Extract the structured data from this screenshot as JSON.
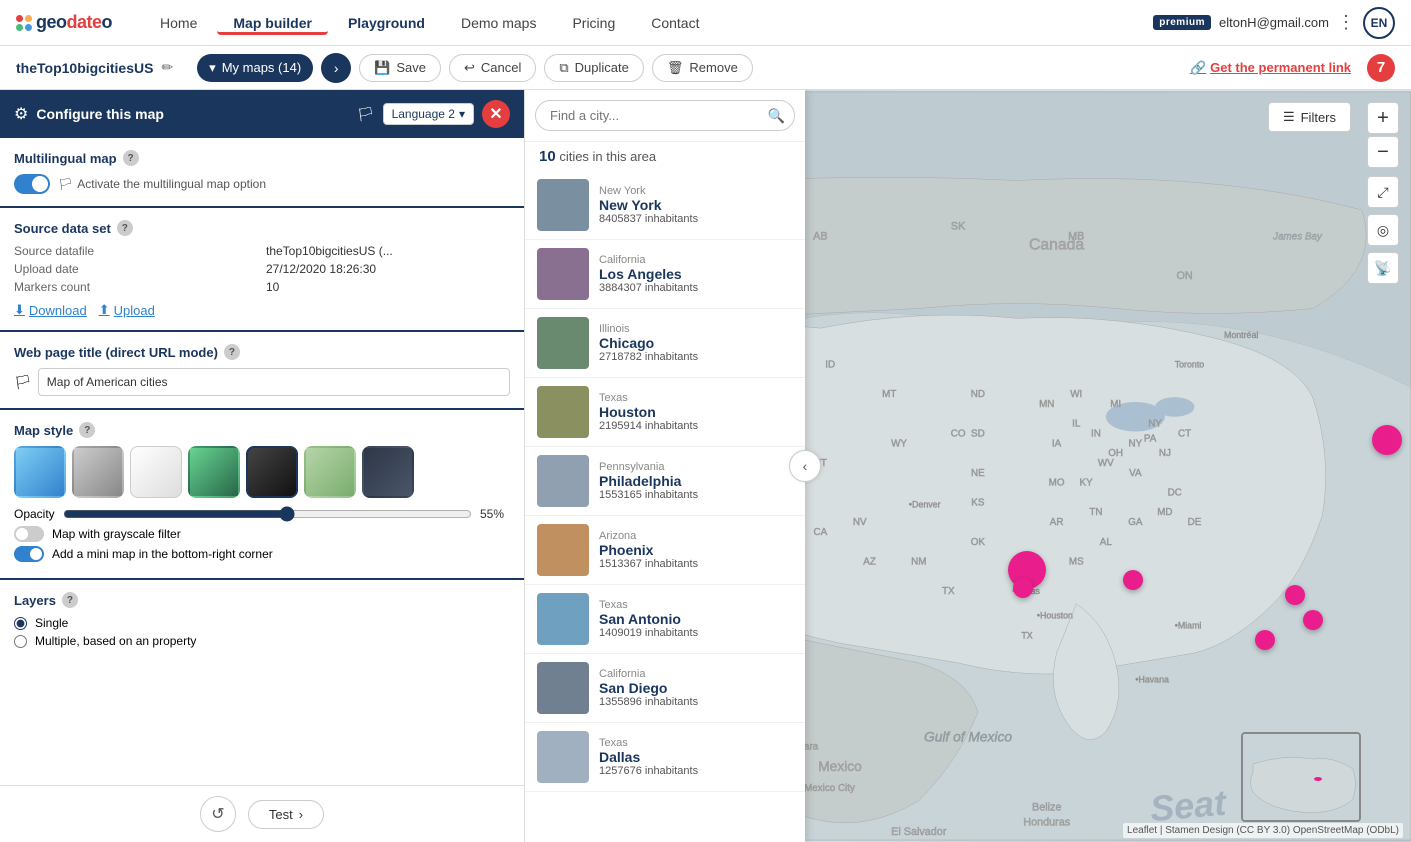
{
  "topNav": {
    "logo": "geodateo",
    "links": [
      {
        "label": "Home",
        "id": "home"
      },
      {
        "label": "Map builder",
        "id": "map-builder",
        "active": true
      },
      {
        "label": "Playground",
        "id": "playground"
      },
      {
        "label": "Demo maps",
        "id": "demo-maps"
      },
      {
        "label": "Pricing",
        "id": "pricing"
      },
      {
        "label": "Contact",
        "id": "contact"
      }
    ],
    "premium_badge": "premium",
    "user_email": "eltonH@gmail.com",
    "lang_btn": "EN"
  },
  "subNav": {
    "map_title": "theTop10bigcitiesUS",
    "my_maps_label": "My maps (14)",
    "save_label": "Save",
    "cancel_label": "Cancel",
    "duplicate_label": "Duplicate",
    "remove_label": "Remove",
    "notification_count": "7",
    "permanent_link_label": "Get the permanent link"
  },
  "leftPanel": {
    "config_title": "Configure this map",
    "lang_selector": "Language 2",
    "sections": {
      "multilingual": {
        "title": "Multilingual map",
        "toggle_on": true,
        "toggle_label": "Activate the multilingual map option"
      },
      "source": {
        "title": "Source data set",
        "source_label": "Source datafile",
        "source_value": "theTop10bigcitiesUS (...",
        "date_label": "Upload date",
        "date_value": "27/12/2020 18:26:30",
        "markers_label": "Markers count",
        "markers_value": "10",
        "download_label": "Download",
        "upload_label": "Upload"
      },
      "webpage": {
        "title": "Web page title (direct URL mode)",
        "value": "Map of American cities"
      },
      "mapstyle": {
        "title": "Map style",
        "opacity_label": "Opacity",
        "opacity_value": "55%",
        "grayscale_label": "Map with grayscale filter",
        "grayscale_on": false,
        "minimap_label": "Add a mini map in the bottom-right corner",
        "minimap_on": true
      },
      "layers": {
        "title": "Layers",
        "single_label": "Single",
        "multiple_label": "Multiple, based on an property"
      }
    }
  },
  "cityPanel": {
    "search_placeholder": "Find a city...",
    "count": "10",
    "count_label": "cities in this area",
    "cities": [
      {
        "state": "New York",
        "name": "New York",
        "pop": "8405837 inhabitants",
        "color": "#8ba4b5"
      },
      {
        "state": "California",
        "name": "Los Angeles",
        "pop": "3884307 inhabitants",
        "color": "#7a6080"
      },
      {
        "state": "Illinois",
        "name": "Chicago",
        "pop": "2718782 inhabitants",
        "color": "#6a8070"
      },
      {
        "state": "Texas",
        "name": "Houston",
        "pop": "2195914 inhabitants",
        "color": "#8a9060"
      },
      {
        "state": "Pennsylvania",
        "name": "Philadelphia",
        "pop": "1553165 inhabitants",
        "color": "#90a0b0"
      },
      {
        "state": "Arizona",
        "name": "Phoenix",
        "pop": "1513367 inhabitants",
        "color": "#c0a070"
      },
      {
        "state": "Texas",
        "name": "San Antonio",
        "pop": "1409019 inhabitants",
        "color": "#70a0c0"
      },
      {
        "state": "California",
        "name": "San Diego",
        "pop": "1355896 inhabitants",
        "color": "#708090"
      },
      {
        "state": "Texas",
        "name": "Dallas",
        "pop": "1257676 inhabitants",
        "color": "#a0b0c0"
      }
    ]
  },
  "mapControls": {
    "filters_label": "Filters",
    "zoom_in": "+",
    "zoom_out": "−",
    "fullscreen": "⤢",
    "locate": "◎",
    "credit": "Leaflet | Stamen Design (CC BY 3.0) OpenStreetMap (ODbL)"
  },
  "bottomPanel": {
    "reset_icon": "↺",
    "test_label": "Test"
  },
  "seatLabel": "Seat"
}
